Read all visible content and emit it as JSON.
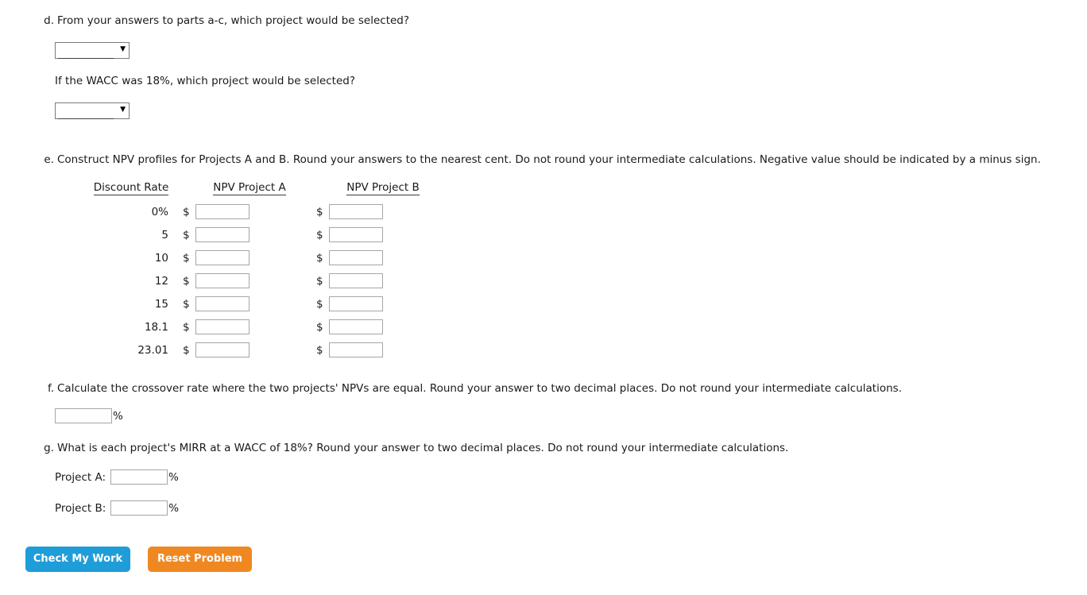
{
  "part_d": {
    "letter": "d.",
    "question": "From your answers to parts a-c, which project would be selected?",
    "dropdown1": {
      "value": "__________",
      "arrow": "chevron-down-icon"
    },
    "followup": "If the WACC was 18%, which project would be selected?",
    "dropdown2": {
      "value": "__________",
      "arrow": "chevron-down-icon"
    }
  },
  "part_e": {
    "letter": "e.",
    "question": "Construct NPV profiles for Projects A and B. Round your answers to the nearest cent. Do not round your intermediate calculations. Negative value should be indicated by a minus sign.",
    "table": {
      "headers": [
        "Discount Rate",
        "NPV Project A",
        "NPV Project B"
      ],
      "currency_symbol": "$",
      "rows": [
        {
          "rate": "0%",
          "npv_a": "",
          "npv_b": ""
        },
        {
          "rate": "5",
          "npv_a": "",
          "npv_b": ""
        },
        {
          "rate": "10",
          "npv_a": "",
          "npv_b": ""
        },
        {
          "rate": "12",
          "npv_a": "",
          "npv_b": ""
        },
        {
          "rate": "15",
          "npv_a": "",
          "npv_b": ""
        },
        {
          "rate": "18.1",
          "npv_a": "",
          "npv_b": ""
        },
        {
          "rate": "23.01",
          "npv_a": "",
          "npv_b": ""
        }
      ]
    }
  },
  "part_f": {
    "letter": "f.",
    "question": "Calculate the crossover rate where the two projects' NPVs are equal. Round your answer to two decimal places. Do not round your intermediate calculations.",
    "answer": {
      "value": "",
      "suffix": "%"
    }
  },
  "part_g": {
    "letter": "g.",
    "question": "What is each project's MIRR at a WACC of 18%? Round your answer to two decimal places. Do not round your intermediate calculations.",
    "project_a": {
      "label": "Project A:",
      "value": "",
      "suffix": "%"
    },
    "project_b": {
      "label": "Project B:",
      "value": "",
      "suffix": "%"
    }
  },
  "buttons": {
    "check": {
      "label": "Check My Work",
      "color": "#1f9dd8"
    },
    "reset": {
      "label": "Reset Problem",
      "color": "#f08821"
    }
  }
}
